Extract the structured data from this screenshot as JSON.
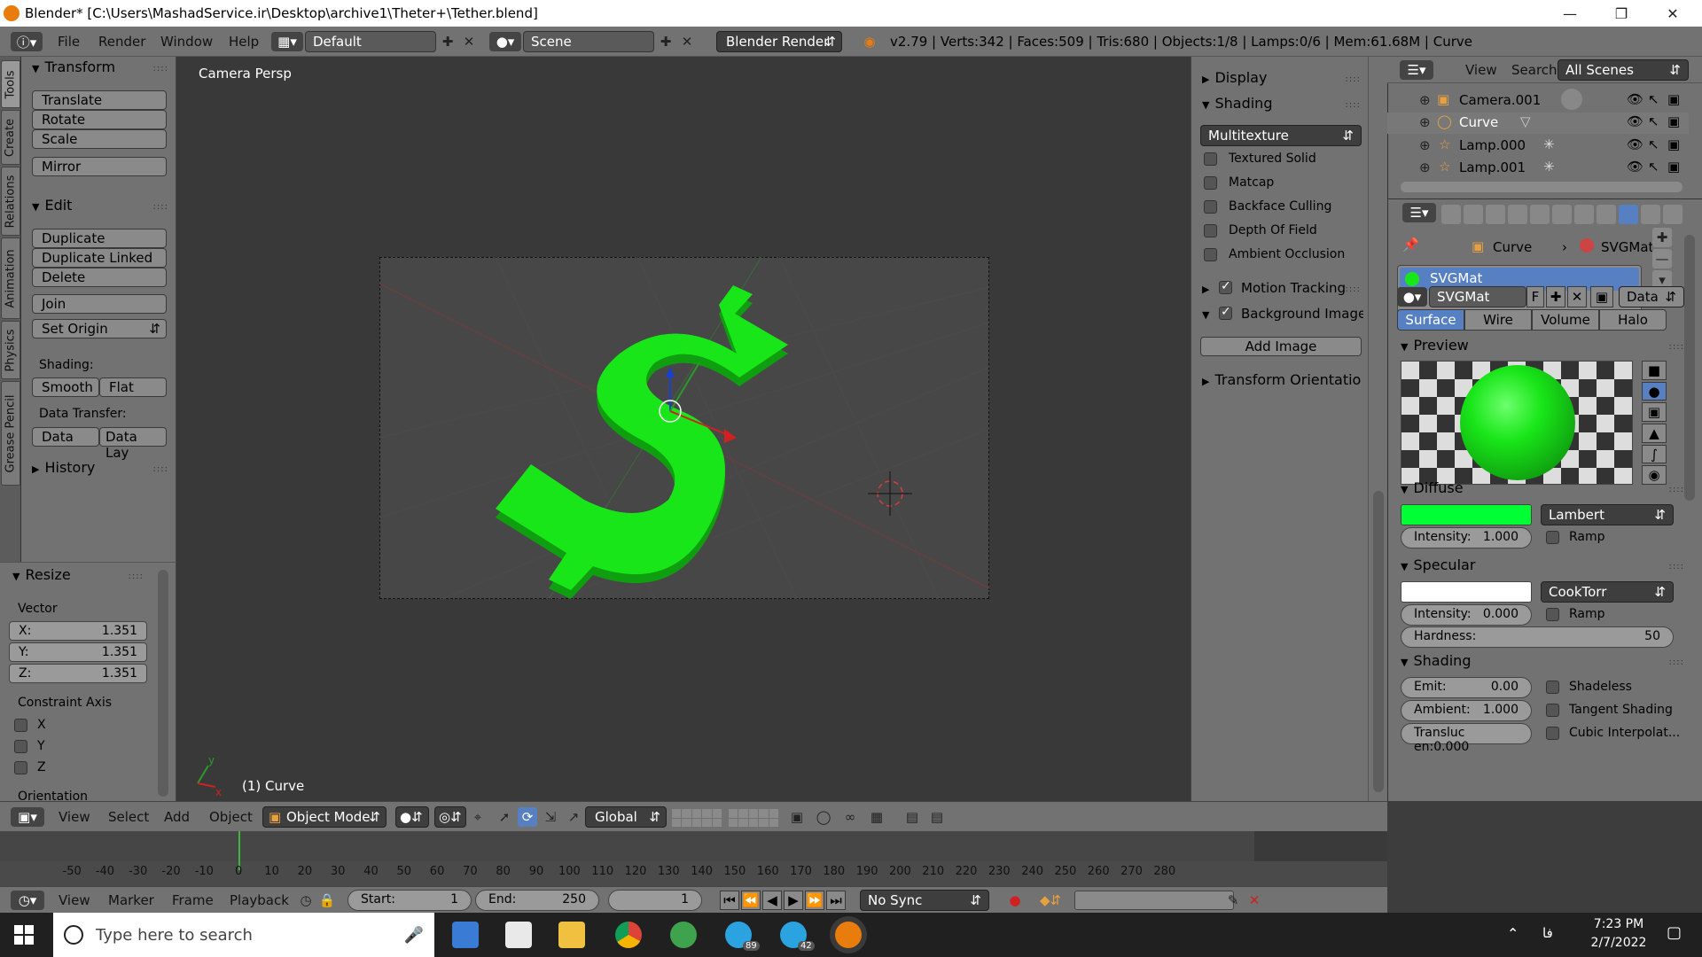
{
  "window": {
    "title": "Blender* [C:\\Users\\MashadService.ir\\Desktop\\archive1\\Theter+\\Tether.blend]"
  },
  "info_header": {
    "menus": [
      "File",
      "Render",
      "Window",
      "Help"
    ],
    "screen_layout": "Default",
    "scene": "Scene",
    "engine": "Blender Render",
    "stats": "v2.79 | Verts:342 | Faces:509 | Tris:680 | Objects:1/8 | Lamps:0/6 | Mem:61.68M | Curve"
  },
  "left_tabs": [
    "Tools",
    "Create",
    "Relations",
    "Animation",
    "Physics",
    "Grease Pencil"
  ],
  "tool_shelf": {
    "transform_header": "Transform",
    "transform_buttons": [
      "Translate",
      "Rotate",
      "Scale",
      "Mirror"
    ],
    "edit_header": "Edit",
    "edit_buttons": [
      "Duplicate",
      "Duplicate Linked",
      "Delete",
      "Join"
    ],
    "set_origin": "Set Origin",
    "shading_label": "Shading:",
    "smooth": "Smooth",
    "flat": "Flat",
    "data_transfer_label": "Data Transfer:",
    "data": "Data",
    "data_lay": "Data Lay",
    "history_header": "History"
  },
  "resize_panel": {
    "header": "Resize",
    "vector_label": "Vector",
    "x_label": "X:",
    "x_value": "1.351",
    "y_label": "Y:",
    "y_value": "1.351",
    "z_label": "Z:",
    "z_value": "1.351",
    "constraint_label": "Constraint Axis",
    "axes": [
      "X",
      "Y",
      "Z"
    ],
    "orientation_label": "Orientation"
  },
  "viewport": {
    "view_name": "Camera Persp",
    "object_label": "(1) Curve",
    "axis_x": "x",
    "axis_y": "y",
    "object_color": "#19e619"
  },
  "n_panel": {
    "display": "Display",
    "shading": "Shading",
    "shading_mode": "Multitexture",
    "options": [
      "Textured Solid",
      "Matcap",
      "Backface Culling",
      "Depth Of Field",
      "Ambient Occlusion"
    ],
    "motion_tracking": "Motion Tracking",
    "background_images": "Background Images",
    "add_image": "Add Image",
    "transform_orientations": "Transform Orientations"
  },
  "outliner": {
    "view": "View",
    "search": "Search",
    "scenes": "All Scenes",
    "rows": [
      "Camera.001",
      "Curve",
      "Lamp.000",
      "Lamp.001"
    ]
  },
  "properties": {
    "breadcrumb_object": "Curve",
    "breadcrumb_material": "SVGMat",
    "material_slot": "SVGMat",
    "material_name": "SVGMat",
    "fake_user": "F",
    "link": "Data",
    "tabs": [
      "Surface",
      "Wire",
      "Volume",
      "Halo"
    ],
    "preview_header": "Preview",
    "diffuse_header": "Diffuse",
    "diffuse_color": "#00ff33",
    "diffuse_shader": "Lambert",
    "diffuse_intensity_label": "Intensity:",
    "diffuse_intensity": "1.000",
    "ramp": "Ramp",
    "specular_header": "Specular",
    "specular_shader": "CookTorr",
    "specular_intensity_label": "Intensity:",
    "specular_intensity": "0.000",
    "hardness_label": "Hardness:",
    "hardness": "50",
    "shading_header": "Shading",
    "emit_label": "Emit:",
    "emit": "0.00",
    "ambient_label": "Ambient:",
    "ambient": "1.000",
    "translucency": "Transluc en:0.000",
    "shadeless": "Shadeless",
    "tangent_shading": "Tangent Shading",
    "cubic_interp": "Cubic Interpolat..."
  },
  "vp_footer": {
    "menus": [
      "View",
      "Select",
      "Add",
      "Object"
    ],
    "mode": "Object Mode",
    "orientation": "Global"
  },
  "timeline": {
    "ticks": [
      "-50",
      "-40",
      "-30",
      "-20",
      "-10",
      "0",
      "10",
      "20",
      "30",
      "40",
      "50",
      "60",
      "70",
      "80",
      "90",
      "100",
      "110",
      "120",
      "130",
      "140",
      "150",
      "160",
      "170",
      "180",
      "190",
      "200",
      "210",
      "220",
      "230",
      "240",
      "250",
      "260",
      "270",
      "280"
    ],
    "menus": [
      "View",
      "Marker",
      "Frame",
      "Playback"
    ],
    "start_label": "Start:",
    "start": "1",
    "end_label": "End:",
    "end": "250",
    "current_frame": "1",
    "sync": "No Sync"
  },
  "taskbar": {
    "search_placeholder": "Type here to search",
    "time": "7:23 PM",
    "date": "2/7/2022",
    "lang": "فا",
    "badge_1": "89",
    "badge_2": "42"
  }
}
